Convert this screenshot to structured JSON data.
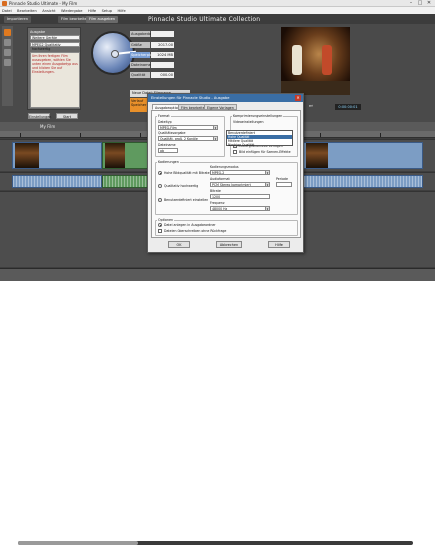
{
  "window": {
    "title": "Pinnacle Studio Ultimate  -  My Film",
    "controls": [
      "–",
      "□",
      "✕"
    ]
  },
  "menu": [
    "Datei",
    "Bearbeiten",
    "Ansicht",
    "Wiedergabe",
    "Hilfe",
    "Setup",
    "Hilfe"
  ],
  "tabs": [
    {
      "label": "Importieren",
      "active": false
    },
    {
      "label": "Film bearbeiten",
      "active": false
    },
    {
      "label": "Film ausgeben",
      "active": true
    }
  ],
  "project_title": "Pinnacle Studio Ultimate Collection",
  "left_panel": {
    "label1": "Ausgabe",
    "select1": "Weitere Geräte",
    "select2": "MPEG2 Qualitativ hochwertig",
    "note": "Um Ihren fertigen Film auszugeben, wählen Sie unten einen Ausgabetyp aus und klicken Sie auf Einstellungen.",
    "btn_settings": "Einstellungen",
    "btn_start": "Start"
  },
  "meter": {
    "rows": [
      {
        "k": "Ausgabedauer",
        "v": ""
      },
      {
        "k": "Größe",
        "v": "2017.00"
      },
      {
        "k": "Speicherplatz",
        "v": "1024 MB"
      },
      {
        "k": "Dateiname",
        "v": ""
      },
      {
        "k": "Qualität",
        "v": "000.00"
      }
    ]
  },
  "info": {
    "line1": "Neue Datei:   Filmname",
    "line2": "Verlauf",
    "line3": "Speicher"
  },
  "transport": {
    "controls": [
      "⏮",
      "◀",
      "▶",
      "⏭"
    ],
    "timecode": "0:00:00:01"
  },
  "timeline": {
    "header": "My Film",
    "ruler_labels": [
      "0:00:00",
      "0:00:10",
      "0:00:20",
      "0:00:30",
      "0:00:40",
      "0:00:50",
      "0:01:00"
    ]
  },
  "dialog": {
    "title": "Einstellungen für Pinnacle Studio - Ausgabe",
    "close": "✕",
    "tabs": [
      "Ausgabeoptionen",
      "Film bearbeiten",
      "Eigene Vorlagen"
    ],
    "group_output": "Format",
    "label_format": "Dateityp",
    "format_value": "MPEG-Film",
    "label_quality": "Qualitätsvorgabe",
    "quality_value": "Qualität, groß, 2 Kanäle",
    "label_filename": "Dateiname",
    "filename_value": "ab",
    "group_compression": "Komprimierungseinstellungen",
    "comp_top": "Videoeinstellungen",
    "comp_dropdown_items": [
      "Benutzerdefiniert",
      "Hohe Qualität",
      "Mittlere Qualität",
      "Niedrige Qualität"
    ],
    "label_resolution": "Auflösung",
    "chk1": "Hintergrundmusik einfügen",
    "chk2": "Bild einfügen für Szenen-Effekte",
    "group_encode": "Kodierungen",
    "radio_encode": [
      "Hohe Bildqualität mit Bitrate",
      "Qualitativ hochwertig",
      "Benutzerdefiniert einstellen"
    ],
    "label_mode": "Kodierungsmodus",
    "mode_value": "MPEG-2",
    "label_audio": "Audioformat",
    "audio_value": "PCM Stereo komprimiert",
    "label_bitrate": "Bitrate",
    "bitrate_value": "1200",
    "label_frequency": "Frequenz",
    "frequency_value": "48000 Hz",
    "label_period": "Periode",
    "group_options": "Optionen",
    "opt1": "Datei anlegen in Ausgabeordner",
    "opt2": "Dateien überschreiben ohne Rückfrage",
    "btn_ok": "OK",
    "btn_cancel": "Abbrechen",
    "btn_help": "Hilfe"
  },
  "colors": {
    "accent_orange": "#e8902a",
    "dialog_title": "#3a6ea5",
    "clip_blue": "#7c9dc4",
    "clip_green": "#5f9a5f"
  }
}
